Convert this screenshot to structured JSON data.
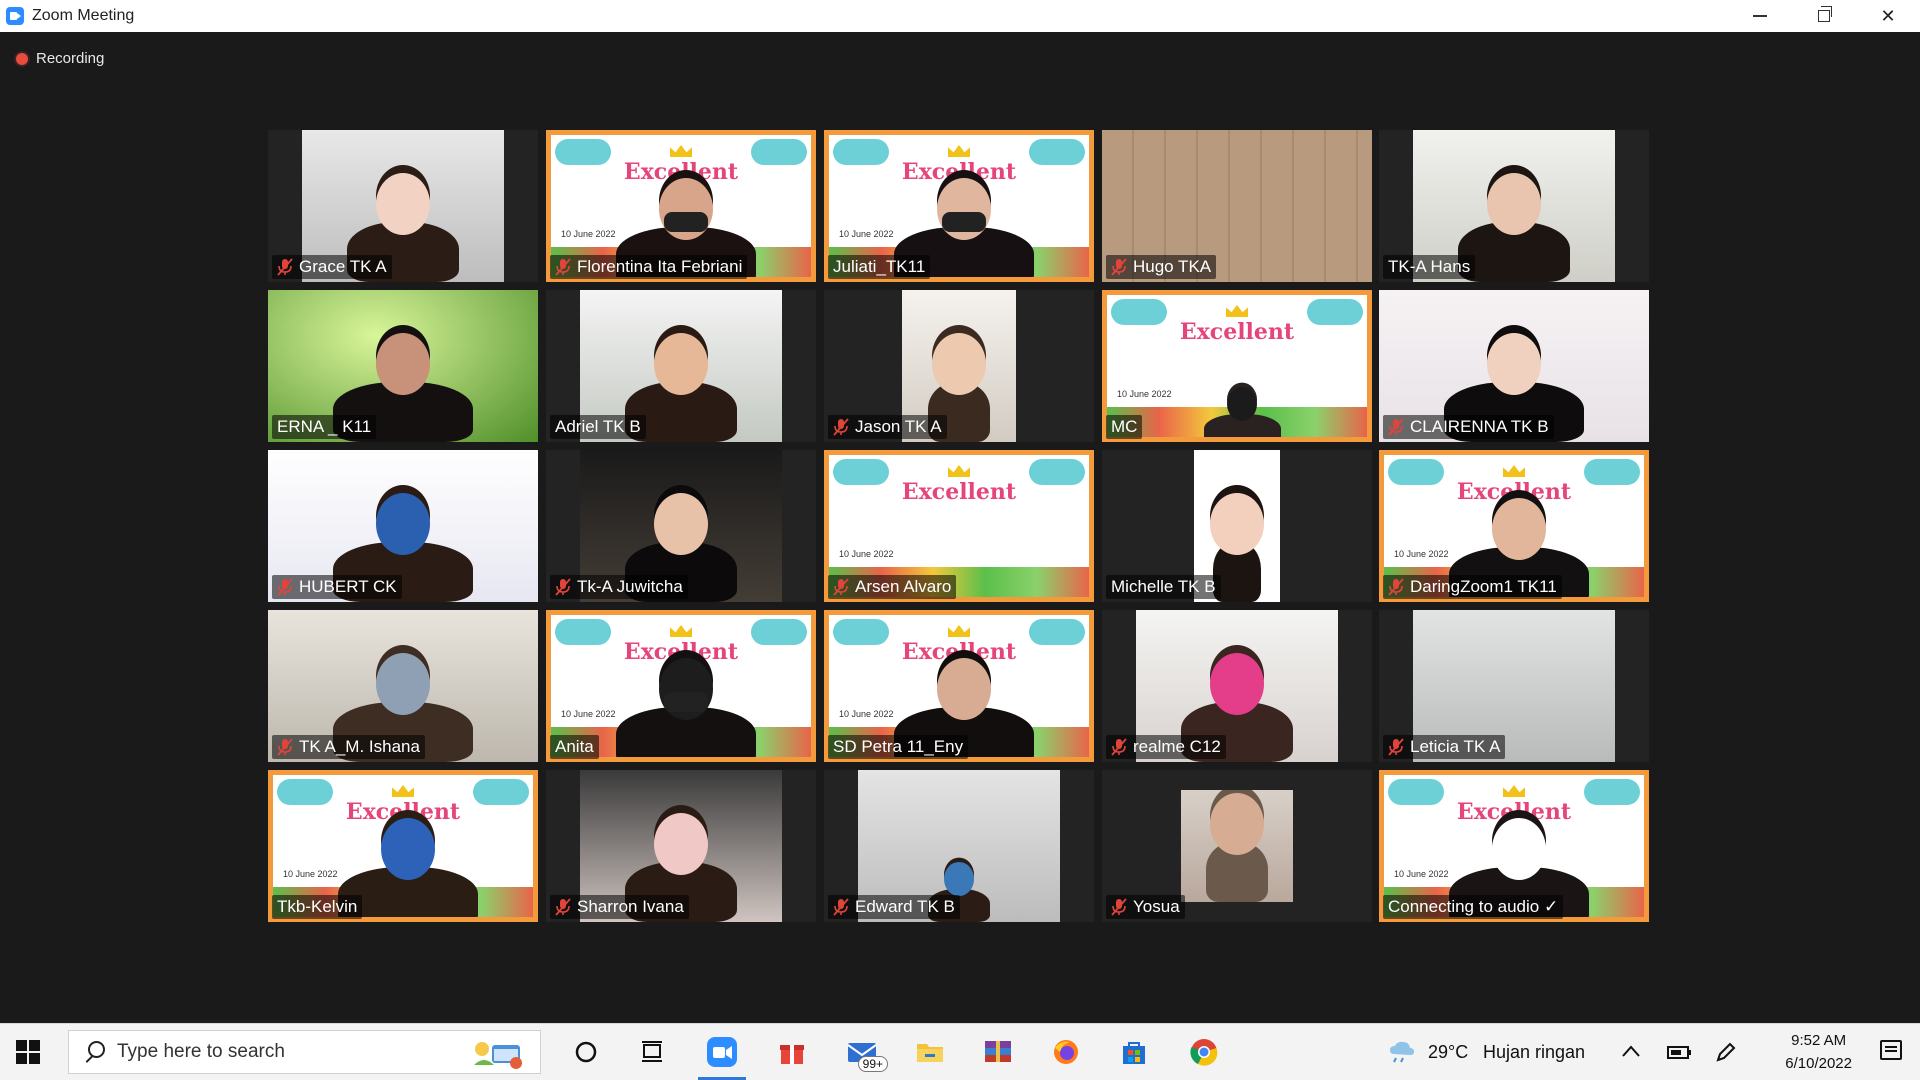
{
  "window": {
    "title": "Zoom Meeting"
  },
  "recording": {
    "label": "Recording"
  },
  "participants": [
    {
      "name": "Grace TK A",
      "muted": true
    },
    {
      "name": "Florentina Ita Febriani",
      "muted": true
    },
    {
      "name": "Juliati_TK11",
      "muted": false
    },
    {
      "name": "Hugo TKA",
      "muted": true
    },
    {
      "name": "TK-A Hans",
      "muted": false
    },
    {
      "name": "ERNA _ K11",
      "muted": false
    },
    {
      "name": "Adriel TK B",
      "muted": false
    },
    {
      "name": "Jason TK A",
      "muted": true
    },
    {
      "name": "MC",
      "muted": false
    },
    {
      "name": "CLAIRENNA TK B",
      "muted": true
    },
    {
      "name": "HUBERT CK",
      "muted": true
    },
    {
      "name": "Tk-A Juwitcha",
      "muted": true
    },
    {
      "name": "Arsen Alvaro",
      "muted": true
    },
    {
      "name": "Michelle TK B",
      "muted": false
    },
    {
      "name": "DaringZoom1 TK11",
      "muted": true
    },
    {
      "name": "TK A_M. Ishana",
      "muted": true
    },
    {
      "name": "Anita",
      "muted": false,
      "active_speaker": true
    },
    {
      "name": "SD Petra 11_Eny",
      "muted": false
    },
    {
      "name": "realme C12",
      "muted": true
    },
    {
      "name": "Leticia TK A",
      "muted": true
    },
    {
      "name": "Tkb-Kelvin",
      "muted": false
    },
    {
      "name": "Sharron Ivana",
      "muted": true
    },
    {
      "name": "Edward TK B",
      "muted": true
    },
    {
      "name": "Yosua",
      "muted": true
    },
    {
      "name": "Connecting to audio ✓",
      "muted": false
    }
  ],
  "banner": {
    "brand": "Excellent",
    "date": "10 June 2022"
  },
  "taskbar": {
    "search_placeholder": "Type here to search",
    "mail_badge": "99+",
    "weather_temp": "29°C",
    "weather_desc": "Hujan ringan",
    "time": "9:52 AM",
    "date": "6/10/2022",
    "icons": [
      "cortana-icon",
      "task-view-icon",
      "zoom-icon",
      "gift-icon",
      "mail-icon",
      "file-explorer-icon",
      "winrar-icon",
      "firefox-icon",
      "store-icon",
      "chrome-icon"
    ]
  },
  "colors": {
    "active_speaker_border": "#d6e65a",
    "muted_mic": "#e0443a",
    "zoom_blue": "#2d8cff"
  }
}
